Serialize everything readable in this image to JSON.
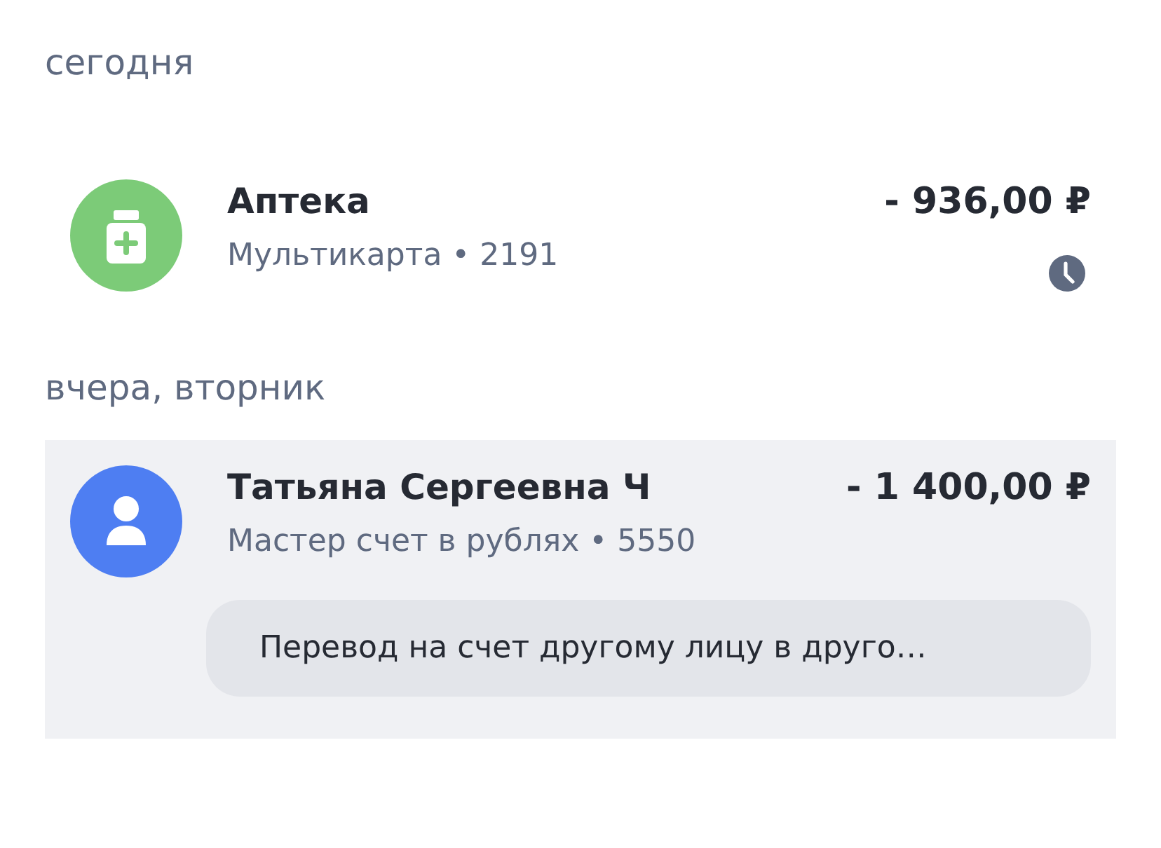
{
  "groups": [
    {
      "heading": "сегодня",
      "transactions": [
        {
          "kind": "pharmacy",
          "color": "#7ccb78",
          "title": "Аптека",
          "subtitle": "Мультикарта • 2191",
          "amount": "- 936,00 ₽",
          "pending": true,
          "selected": false
        }
      ]
    },
    {
      "heading": "вчера, вторник",
      "transactions": [
        {
          "kind": "person",
          "color": "#4e7ef2",
          "title": "Татьяна Сергеевна Ч",
          "subtitle": "Мастер счет в рублях • 5550",
          "amount": "- 1 400,00 ₽",
          "pending": false,
          "selected": true,
          "note": "Перевод на счет другому лицу в друго…"
        }
      ]
    }
  ]
}
